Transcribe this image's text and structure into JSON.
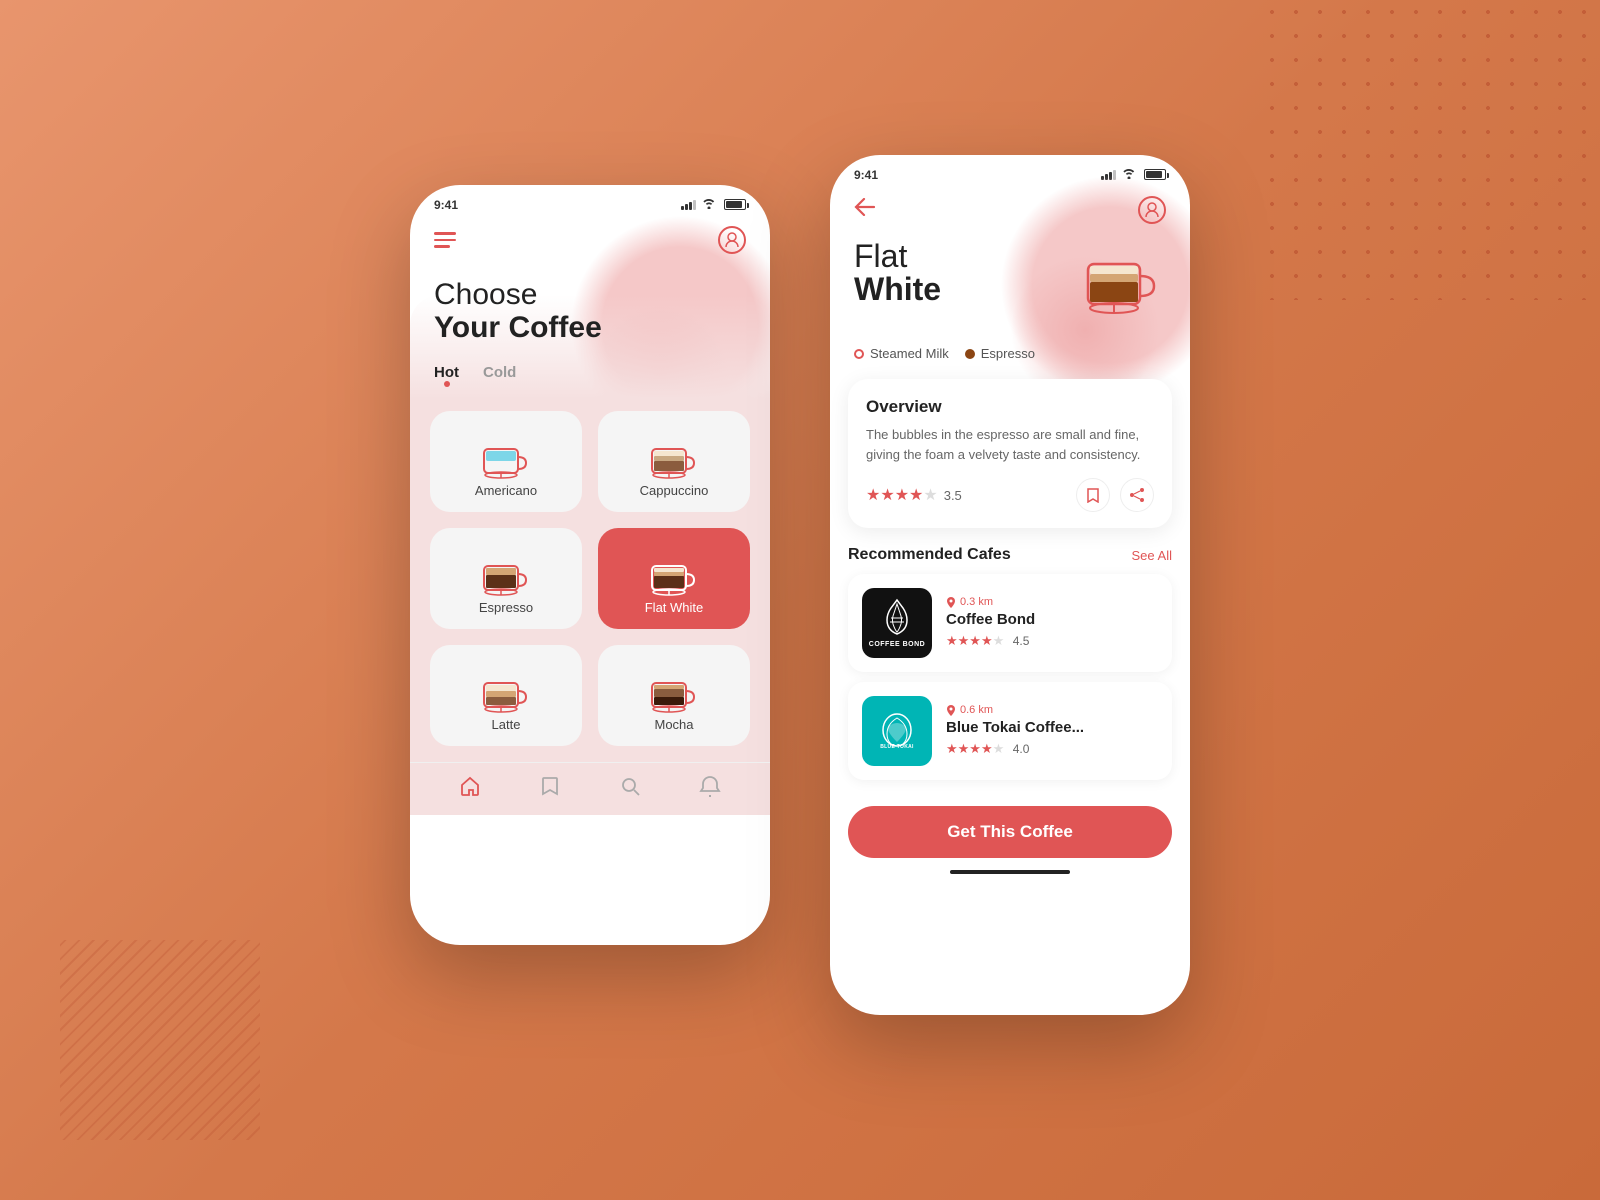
{
  "background": {
    "color": "#d4784a"
  },
  "phone1": {
    "status_time": "9:41",
    "header": {
      "menu_label": "menu",
      "user_label": "user"
    },
    "title": {
      "line1": "Choose",
      "line2": "Your Coffee"
    },
    "tabs": [
      {
        "label": "Hot",
        "active": true
      },
      {
        "label": "Cold",
        "active": false
      }
    ],
    "coffees": [
      {
        "id": "americano",
        "name": "Americano",
        "selected": false
      },
      {
        "id": "cappuccino",
        "name": "Cappuccino",
        "selected": false
      },
      {
        "id": "espresso",
        "name": "Espresso",
        "selected": false
      },
      {
        "id": "flat-white",
        "name": "Flat White",
        "selected": true
      },
      {
        "id": "latte",
        "name": "Latte",
        "selected": false
      },
      {
        "id": "mocha",
        "name": "Mocha",
        "selected": false
      }
    ],
    "nav": [
      {
        "id": "home",
        "label": "home",
        "active": true
      },
      {
        "id": "bookmark",
        "label": "bookmark",
        "active": false
      },
      {
        "id": "search",
        "label": "search",
        "active": false
      },
      {
        "id": "bell",
        "label": "bell",
        "active": false
      }
    ]
  },
  "phone2": {
    "status_time": "9:41",
    "header": {
      "back_label": "back",
      "user_label": "user"
    },
    "title": {
      "line1": "Flat",
      "line2": "White"
    },
    "ingredients": [
      {
        "name": "Steamed Milk",
        "dot_type": "milk"
      },
      {
        "name": "Espresso",
        "dot_type": "espresso"
      }
    ],
    "overview": {
      "title": "Overview",
      "text": "The bubbles in the espresso are small and fine, giving the foam a velvety taste and consistency.",
      "rating": "3.5",
      "stars_full": 3,
      "stars_half": 1,
      "stars_empty": 1
    },
    "recommended_section": {
      "title": "Recommended Cafes",
      "see_all": "See All"
    },
    "cafes": [
      {
        "id": "coffee-bond",
        "name": "Coffee Bond",
        "distance": "0.3 km",
        "rating": "4.5",
        "logo_text": "COFFEE BOND",
        "logo_class": "cafe-logo-bond"
      },
      {
        "id": "blue-tokai",
        "name": "Blue Tokai Coffee...",
        "distance": "0.6 km",
        "rating": "4.0",
        "logo_text": "BLUE TOKAI",
        "logo_class": "cafe-logo-tokai"
      }
    ],
    "cta_button": "Get This Coffee"
  }
}
